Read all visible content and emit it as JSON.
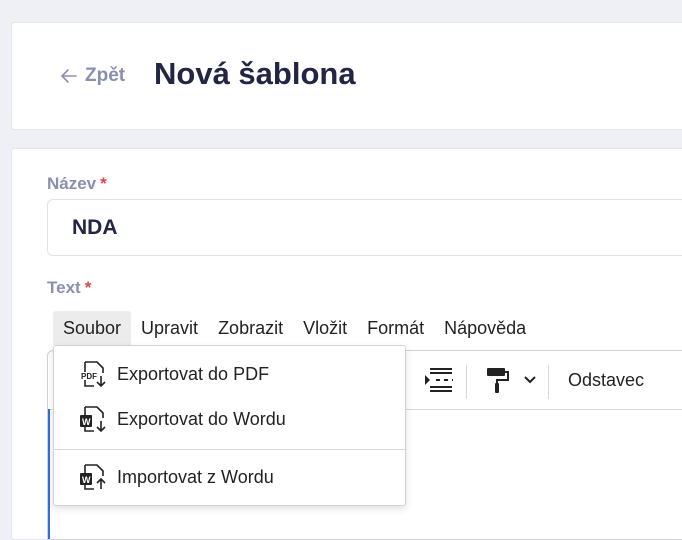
{
  "header": {
    "back_label": "Zpět",
    "title": "Nová šablona"
  },
  "form": {
    "name_label": "Název",
    "name_value": "NDA",
    "text_label": "Text",
    "required_mark": "*"
  },
  "editor": {
    "menu": [
      "Soubor",
      "Upravit",
      "Zobrazit",
      "Vložit",
      "Formát",
      "Nápověda"
    ],
    "active_menu": "Soubor",
    "block_format": "Odstavec",
    "file_menu": {
      "items": [
        {
          "label": "Exportovat do PDF",
          "icon": "export-pdf-icon"
        },
        {
          "label": "Exportovat do Wordu",
          "icon": "export-word-icon"
        },
        {
          "label": "Importovat z Wordu",
          "icon": "import-word-icon"
        }
      ]
    }
  },
  "colors": {
    "background": "#eef0f6",
    "title": "#232545",
    "muted_label": "#8a8fb0",
    "required": "#e0434b",
    "focus_border": "#2f6fe3"
  }
}
